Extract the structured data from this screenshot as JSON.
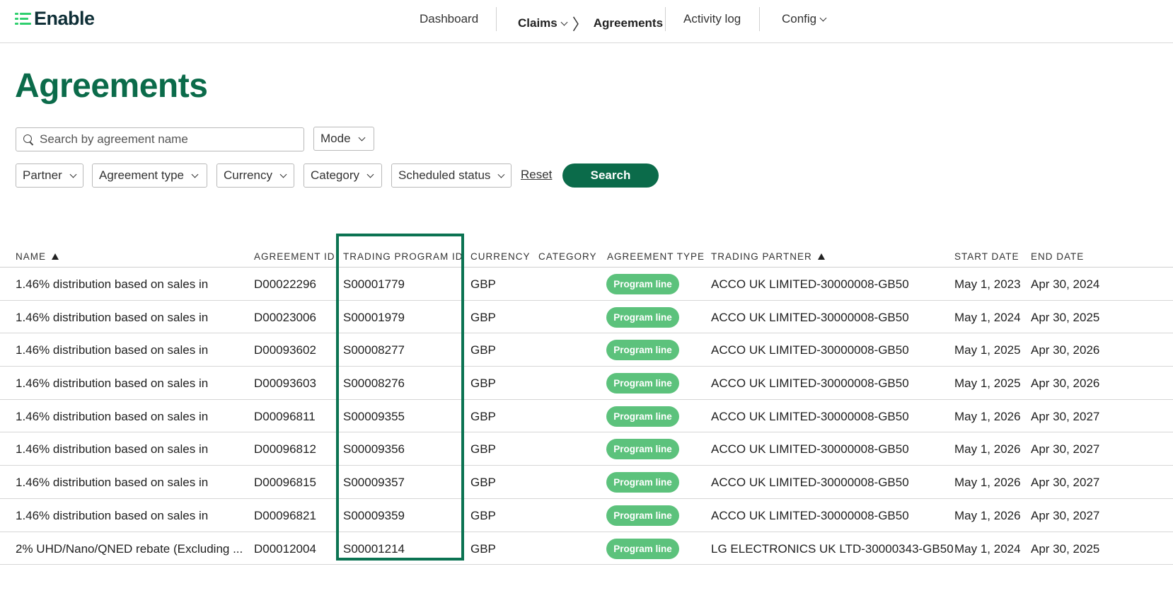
{
  "app": {
    "logo_text": "Enable"
  },
  "nav": {
    "dashboard": "Dashboard",
    "claims": "Claims",
    "breadcrumb_sep": "〉",
    "agreements": "Agreements",
    "activity_log": "Activity log",
    "config": "Config"
  },
  "page": {
    "title": "Agreements"
  },
  "filters": {
    "search_placeholder": "Search by agreement name",
    "search_value": "",
    "mode": "Mode",
    "partner": "Partner",
    "agreement_type": "Agreement type",
    "currency": "Currency",
    "category": "Category",
    "scheduled_status": "Scheduled status",
    "reset": "Reset",
    "search_button": "Search"
  },
  "table": {
    "headers": {
      "name": "Name",
      "agreement_id": "Agreement ID",
      "trading_program_id": "Trading Program ID",
      "currency": "Currency",
      "category": "Category",
      "agreement_type": "Agreement type",
      "trading_partner": "Trading partner",
      "start_date": "Start date",
      "end_date": "End date"
    },
    "rows": [
      {
        "name": "1.46% distribution based on sales in",
        "agreement_id": "D00022296",
        "trading_program_id": "S00001779",
        "currency": "GBP",
        "category": "",
        "agreement_type": "Program line",
        "trading_partner": "ACCO UK LIMITED-30000008-GB50",
        "start_date": "May 1, 2023",
        "end_date": "Apr 30, 2024"
      },
      {
        "name": "1.46% distribution based on sales in",
        "agreement_id": "D00023006",
        "trading_program_id": "S00001979",
        "currency": "GBP",
        "category": "",
        "agreement_type": "Program line",
        "trading_partner": "ACCO UK LIMITED-30000008-GB50",
        "start_date": "May 1, 2024",
        "end_date": "Apr 30, 2025"
      },
      {
        "name": "1.46% distribution based on sales in",
        "agreement_id": "D00093602",
        "trading_program_id": "S00008277",
        "currency": "GBP",
        "category": "",
        "agreement_type": "Program line",
        "trading_partner": "ACCO UK LIMITED-30000008-GB50",
        "start_date": "May 1, 2025",
        "end_date": "Apr 30, 2026"
      },
      {
        "name": "1.46% distribution based on sales in",
        "agreement_id": "D00093603",
        "trading_program_id": "S00008276",
        "currency": "GBP",
        "category": "",
        "agreement_type": "Program line",
        "trading_partner": "ACCO UK LIMITED-30000008-GB50",
        "start_date": "May 1, 2025",
        "end_date": "Apr 30, 2026"
      },
      {
        "name": "1.46% distribution based on sales in",
        "agreement_id": "D00096811",
        "trading_program_id": "S00009355",
        "currency": "GBP",
        "category": "",
        "agreement_type": "Program line",
        "trading_partner": "ACCO UK LIMITED-30000008-GB50",
        "start_date": "May 1, 2026",
        "end_date": "Apr 30, 2027"
      },
      {
        "name": "1.46% distribution based on sales in",
        "agreement_id": "D00096812",
        "trading_program_id": "S00009356",
        "currency": "GBP",
        "category": "",
        "agreement_type": "Program line",
        "trading_partner": "ACCO UK LIMITED-30000008-GB50",
        "start_date": "May 1, 2026",
        "end_date": "Apr 30, 2027"
      },
      {
        "name": "1.46% distribution based on sales in",
        "agreement_id": "D00096815",
        "trading_program_id": "S00009357",
        "currency": "GBP",
        "category": "",
        "agreement_type": "Program line",
        "trading_partner": "ACCO UK LIMITED-30000008-GB50",
        "start_date": "May 1, 2026",
        "end_date": "Apr 30, 2027"
      },
      {
        "name": "1.46% distribution based on sales in",
        "agreement_id": "D00096821",
        "trading_program_id": "S00009359",
        "currency": "GBP",
        "category": "",
        "agreement_type": "Program line",
        "trading_partner": "ACCO UK LIMITED-30000008-GB50",
        "start_date": "May 1, 2026",
        "end_date": "Apr 30, 2027"
      },
      {
        "name": "2% UHD/Nano/QNED rebate (Excluding ...",
        "agreement_id": "D00012004",
        "trading_program_id": "S00001214",
        "currency": "GBP",
        "category": "",
        "agreement_type": "Program line",
        "trading_partner": "LG ELECTRONICS UK LTD-30000343-GB50",
        "start_date": "May 1, 2024",
        "end_date": "Apr 30, 2025"
      }
    ]
  },
  "colors": {
    "brand": "#0b6b4a",
    "logo_accent": "#2fcf6e",
    "pill": "#5cc27c",
    "highlight_border": "#0b7352"
  }
}
